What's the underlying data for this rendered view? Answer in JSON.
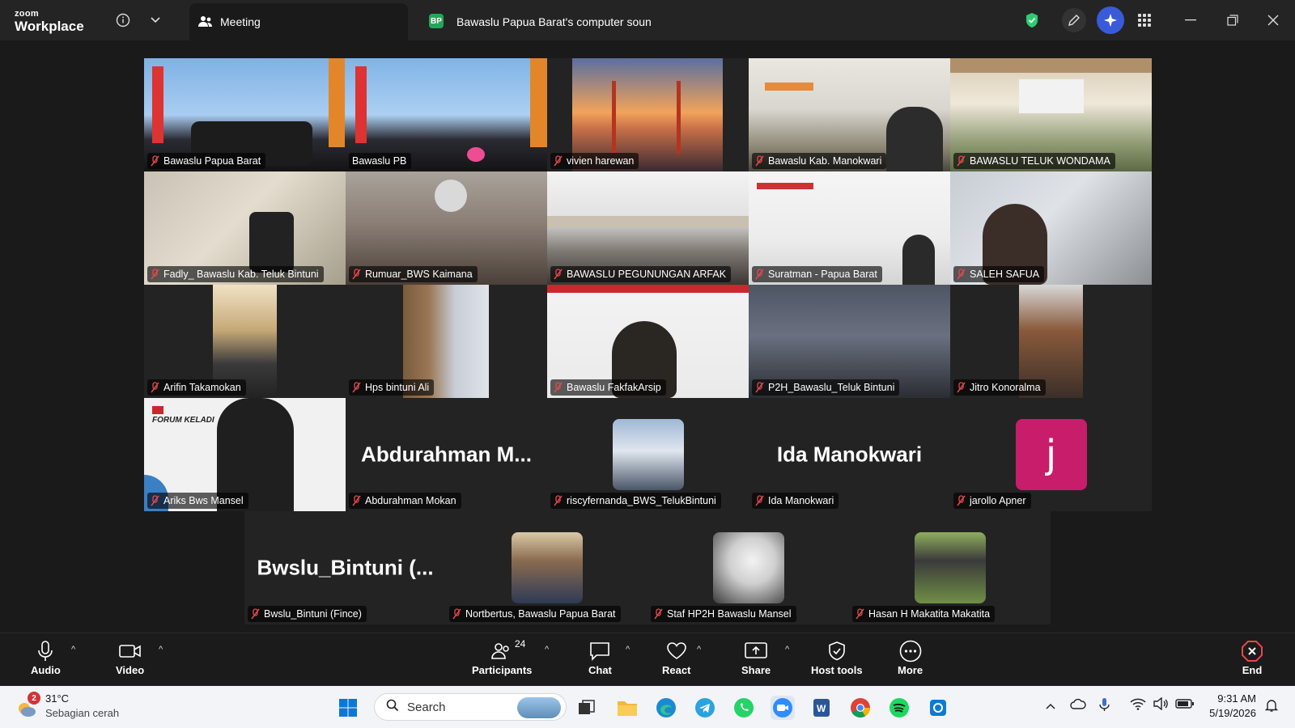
{
  "app": {
    "logo_line1": "zoom",
    "logo_line2": "Workplace"
  },
  "tabs": [
    {
      "label": "Meeting"
    },
    {
      "badge": "BP",
      "label": "Bawaslu Papua Barat's computer soun"
    }
  ],
  "participants_grid": [
    {
      "name": "Bawaslu Papua Barat",
      "mode": "video",
      "active": true
    },
    {
      "name": "Bawaslu PB",
      "mode": "video"
    },
    {
      "name": "vivien harewan",
      "mode": "video"
    },
    {
      "name": "Bawaslu Kab. Manokwari",
      "mode": "video"
    },
    {
      "name": "BAWASLU TELUK WONDAMA",
      "mode": "video"
    },
    {
      "name": "Fadly_ Bawaslu Kab. Teluk Bintuni",
      "mode": "video"
    },
    {
      "name": "Rumuar_BWS Kaimana",
      "mode": "video"
    },
    {
      "name": "BAWASLU PEGUNUNGAN ARFAK",
      "mode": "video"
    },
    {
      "name": "Suratman - Papua Barat",
      "mode": "video"
    },
    {
      "name": "SALEH SAFUA",
      "mode": "video"
    },
    {
      "name": "Arifin Takamokan",
      "mode": "video"
    },
    {
      "name": "Hps bintuni Ali",
      "mode": "video"
    },
    {
      "name": "Bawaslu FakfakArsip",
      "mode": "video"
    },
    {
      "name": "P2H_Bawaslu_Teluk Bintuni",
      "mode": "video"
    },
    {
      "name": "Jitro Konoralma",
      "mode": "video"
    },
    {
      "name": "Ariks Bws Mansel",
      "mode": "video",
      "slide_text": "FORUM KELADI"
    },
    {
      "name": "Abdurahman Mokan",
      "mode": "name",
      "display": "Abdurahman  M..."
    },
    {
      "name": "riscyfernanda_BWS_TelukBintuni",
      "mode": "avatar"
    },
    {
      "name": "Ida Manokwari",
      "mode": "name",
      "display": "Ida Manokwari"
    },
    {
      "name": "jarollo Apner",
      "mode": "avatar",
      "initial": "j"
    }
  ],
  "participants_row2": [
    {
      "name": "Bwslu_Bintuni (Fince)",
      "mode": "name",
      "display": "Bwslu_Bintuni  (..."
    },
    {
      "name": "Nortbertus, Bawaslu Papua Barat",
      "mode": "avatar"
    },
    {
      "name": "Staf HP2H Bawaslu Mansel",
      "mode": "avatar"
    },
    {
      "name": "Hasan H Makatita Makatita",
      "mode": "avatar"
    }
  ],
  "controls": {
    "audio": "Audio",
    "video": "Video",
    "participants": "Participants",
    "participants_count": "24",
    "chat": "Chat",
    "react": "React",
    "share": "Share",
    "host_tools": "Host tools",
    "more": "More",
    "end": "End"
  },
  "taskbar": {
    "weather_badge": "2",
    "temperature": "31°C",
    "weather_desc": "Sebagian cerah",
    "search_placeholder": "Search",
    "time": "9:31 AM",
    "date": "5/19/2026"
  },
  "colors": {
    "active_border": "#2ecc71",
    "mute_icon": "#e5484d",
    "avatar_j": "#c81d6b",
    "shield": "#2ecc71"
  }
}
